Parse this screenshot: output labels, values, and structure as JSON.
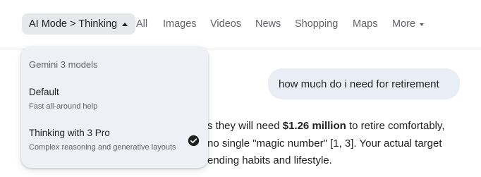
{
  "tabs": {
    "mode_label": "AI Mode > Thinking",
    "all": "All",
    "images": "Images",
    "videos": "Videos",
    "news": "News",
    "shopping": "Shopping",
    "maps": "Maps",
    "more": "More"
  },
  "query": {
    "text": "how much do i need for retirement"
  },
  "answer": {
    "line1_prefix": "s they will need ",
    "line1_bold": "$1.26 million",
    "line1_suffix": " to retire comfortably,",
    "line2": "no single \"magic number\" [1, 3]. Your actual target",
    "line3": "ending habits and lifestyle."
  },
  "dropdown": {
    "header": "Gemini 3 models",
    "items": [
      {
        "title": "Default",
        "desc": "Fast all-around help",
        "selected": false
      },
      {
        "title": "Thinking with 3 Pro",
        "desc": "Complex reasoning and generative layouts",
        "selected": true
      }
    ]
  },
  "icons": {
    "selected": "check-circle-icon",
    "mode_caret": "caret-up-icon",
    "more_caret": "caret-down-icon"
  },
  "colors": {
    "chip_bg": "#e7e8ec",
    "bubble_bg": "#e9eef6",
    "menu_bg": "#eef0f5"
  }
}
